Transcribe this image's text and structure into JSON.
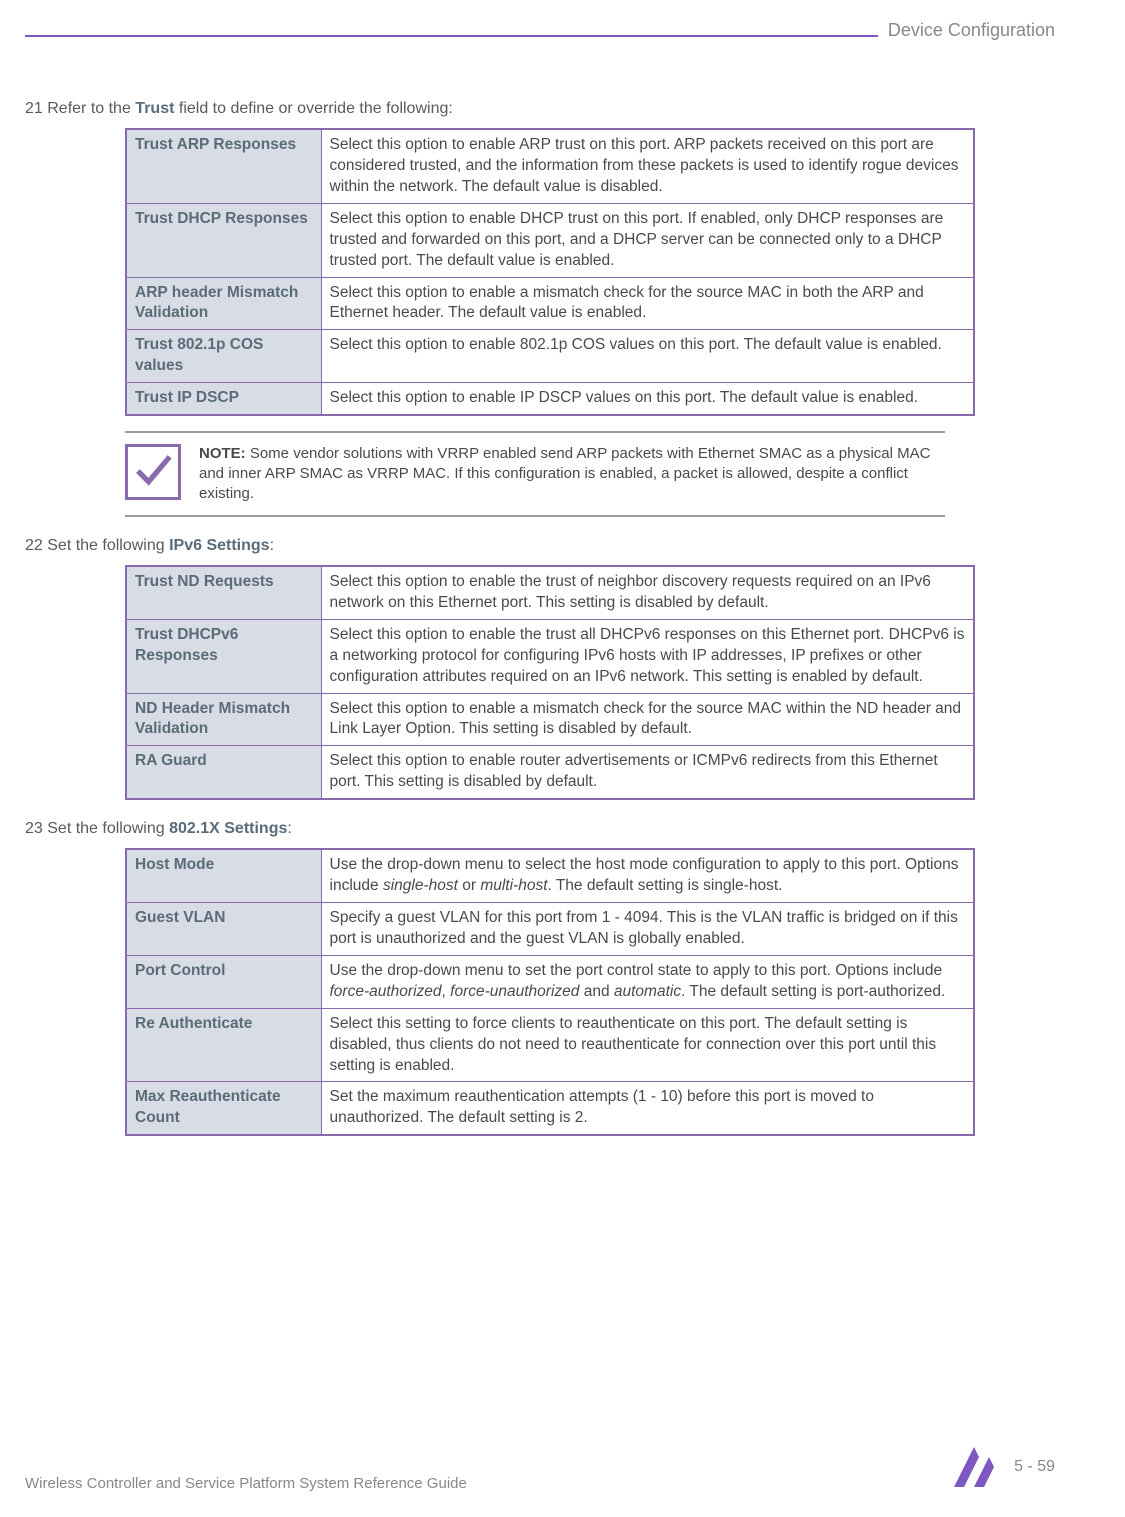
{
  "header": {
    "title": "Device Configuration"
  },
  "step21": {
    "num": "21",
    "prefix": "Refer to the ",
    "bold": "Trust",
    "suffix": " field to define or override the following:"
  },
  "table1": {
    "rows": [
      {
        "label": "Trust ARP Responses",
        "desc": "Select this option to enable ARP trust on this port. ARP packets received on this port are considered trusted, and the information from these packets is used to identify rogue devices within the network. The default value is disabled."
      },
      {
        "label": "Trust DHCP Responses",
        "desc": "Select this option to enable DHCP trust on this port. If enabled, only DHCP responses are trusted and forwarded on this port, and a DHCP server can be connected only to a DHCP trusted port. The default value is enabled."
      },
      {
        "label": "ARP header Mismatch Validation",
        "desc": "Select this option to enable a mismatch check for the source MAC in both the ARP and Ethernet header. The default value is enabled."
      },
      {
        "label": "Trust 802.1p COS values",
        "desc": "Select this option to enable 802.1p COS values on this port. The default value is enabled."
      },
      {
        "label": "Trust IP DSCP",
        "desc": "Select this option to enable IP DSCP values on this port. The default value is enabled."
      }
    ]
  },
  "note": {
    "label": "NOTE:",
    "text": " Some vendor solutions with VRRP enabled send ARP packets with Ethernet SMAC as a physical MAC and inner ARP SMAC as VRRP MAC. If this configuration is enabled, a packet is allowed, despite a conflict existing."
  },
  "step22": {
    "num": "22",
    "prefix": " Set the following ",
    "bold": "IPv6 Settings",
    "suffix": ":"
  },
  "table2": {
    "rows": [
      {
        "label": "Trust ND Requests",
        "desc": "Select this option to enable the trust of neighbor discovery requests required on an IPv6 network on this Ethernet port. This setting is disabled by default."
      },
      {
        "label": "Trust DHCPv6 Responses",
        "desc": "Select this option to enable the trust all DHCPv6 responses on this Ethernet port. DHCPv6 is a networking protocol for configuring IPv6 hosts with IP addresses, IP prefixes or other configuration attributes required on an IPv6 network. This setting is enabled by default."
      },
      {
        "label": "ND Header Mismatch Validation",
        "desc": "Select this option to enable a mismatch check for the source MAC within the ND header and Link Layer Option. This setting is disabled by default."
      },
      {
        "label": "RA Guard",
        "desc": "Select this option to enable router advertisements or ICMPv6 redirects from this Ethernet port. This setting is disabled by default."
      }
    ]
  },
  "step23": {
    "num": "23",
    "prefix": " Set the following ",
    "bold": "802.1X Settings",
    "suffix": ":"
  },
  "table3": {
    "rows": [
      {
        "label": "Host Mode",
        "desc_parts": [
          {
            "t": "Use the drop-down menu to select the host mode configuration to apply to this port. Options include "
          },
          {
            "t": "single-host",
            "i": true
          },
          {
            "t": " or "
          },
          {
            "t": "multi-host",
            "i": true
          },
          {
            "t": ". The default setting is single-host."
          }
        ]
      },
      {
        "label": "Guest VLAN",
        "desc": "Specify a guest VLAN for this port from 1 - 4094. This is the VLAN traffic is bridged on if this port is unauthorized and the guest VLAN is globally enabled."
      },
      {
        "label": "Port Control",
        "desc_parts": [
          {
            "t": "Use the drop-down menu to set the port control state to apply to this port. Options include "
          },
          {
            "t": "force-authorized",
            "i": true
          },
          {
            "t": ", "
          },
          {
            "t": "force-unauthorized",
            "i": true
          },
          {
            "t": " and "
          },
          {
            "t": "automatic",
            "i": true
          },
          {
            "t": ". The default setting is port-authorized."
          }
        ]
      },
      {
        "label": "Re Authenticate",
        "desc": "Select this setting to force clients to reauthenticate on this port. The default setting is disabled, thus clients do not need to reauthenticate for connection over this port until this setting is enabled."
      },
      {
        "label": "Max Reauthenticate Count",
        "desc": "Set the maximum reauthentication attempts (1 - 10) before this port is moved to unauthorized. The default setting is 2."
      }
    ]
  },
  "footer": {
    "text": "Wireless Controller and Service Platform System Reference Guide",
    "page": "5 - 59"
  }
}
